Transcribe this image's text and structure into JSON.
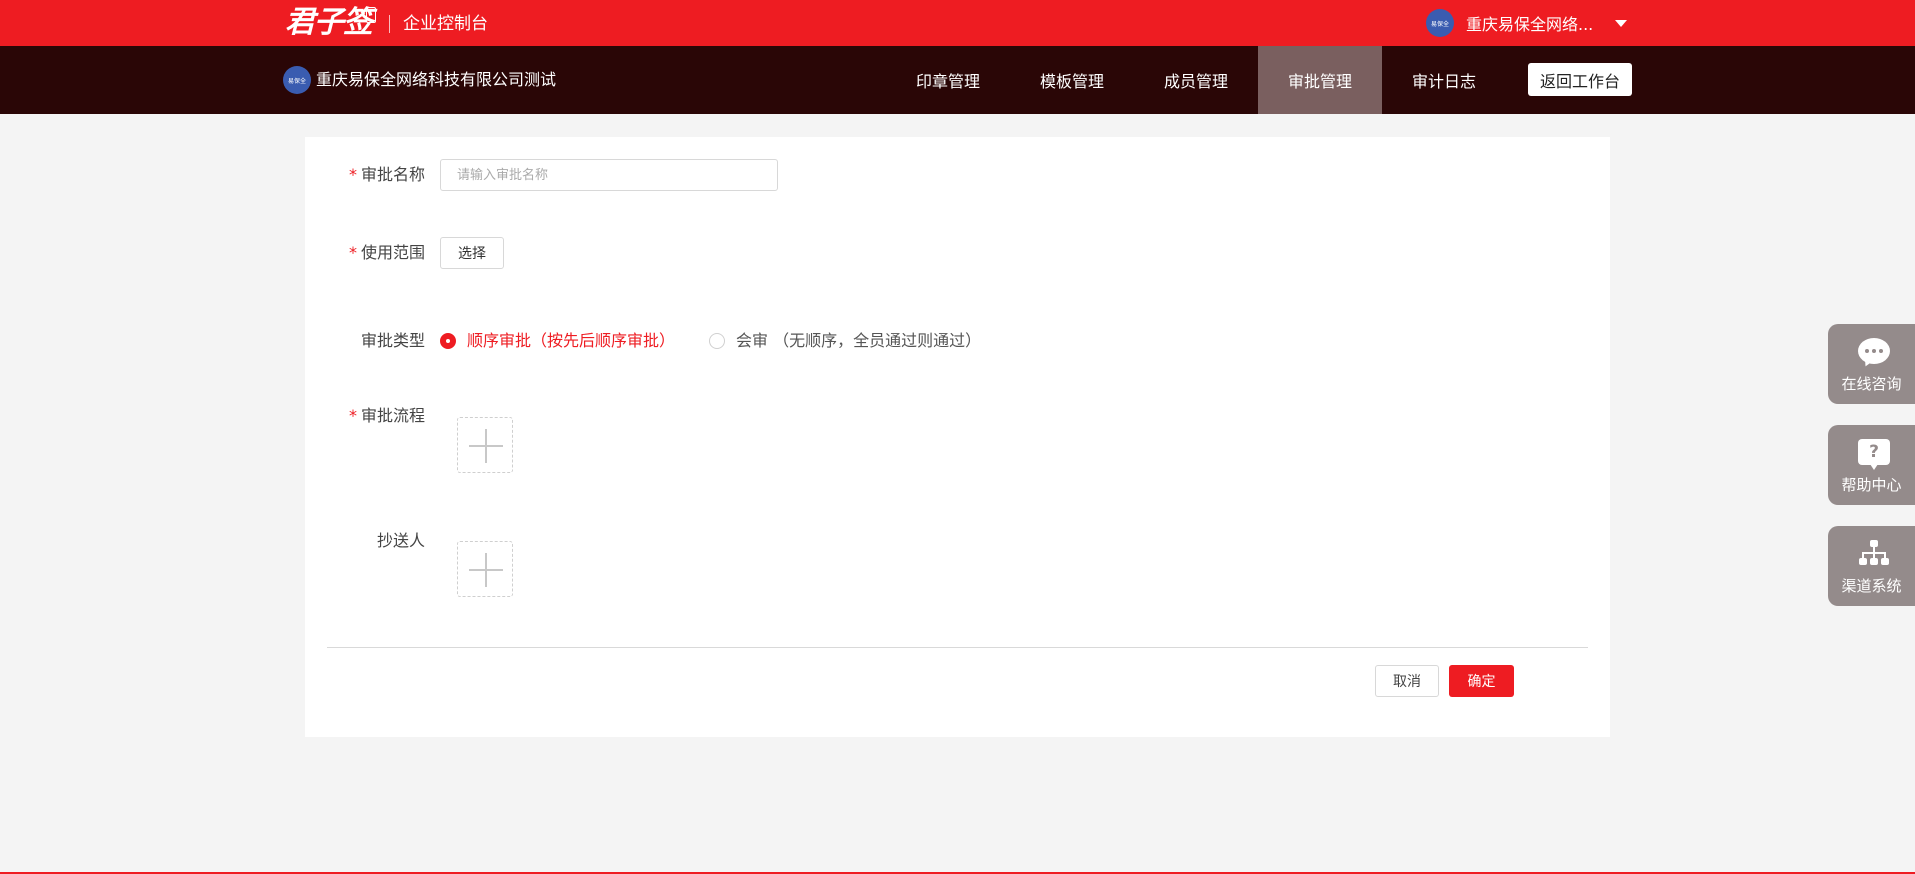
{
  "topbar": {
    "brand": "君子签",
    "subtitle": "企业控制台",
    "user_name": "重庆易保全网络...",
    "avatar_text": "易保全"
  },
  "navbar": {
    "org_name": "重庆易保全网络科技有限公司测试",
    "org_logo_text": "易保全",
    "items": [
      {
        "label": "印章管理"
      },
      {
        "label": "模板管理"
      },
      {
        "label": "成员管理"
      },
      {
        "label": "审批管理",
        "active": true
      },
      {
        "label": "审计日志"
      }
    ],
    "back_button": "返回工作台"
  },
  "form": {
    "name": {
      "label": "审批名称",
      "required": "*",
      "placeholder": "请输入审批名称",
      "value": ""
    },
    "scope": {
      "label": "使用范围",
      "required": "*",
      "button": "选择"
    },
    "type": {
      "label": "审批类型",
      "options": [
        {
          "label": "顺序审批（按先后顺序审批）",
          "selected": true
        },
        {
          "label": "会审 （无顺序，全员通过则通过）",
          "selected": false
        }
      ]
    },
    "flow": {
      "label": "审批流程",
      "required": "*"
    },
    "cc": {
      "label": "抄送人"
    },
    "cancel": "取消",
    "confirm": "确定"
  },
  "side_widgets": [
    {
      "label": "在线咨询",
      "icon": "chat-bubble-icon"
    },
    {
      "label": "帮助中心",
      "icon": "help-icon"
    },
    {
      "label": "渠道系统",
      "icon": "org-chart-icon"
    }
  ],
  "colors": {
    "brand_red": "#ee1c22",
    "nav_dark": "#2a0606",
    "nav_active": "#7a5f5f",
    "widget_gray": "#948b8b"
  }
}
